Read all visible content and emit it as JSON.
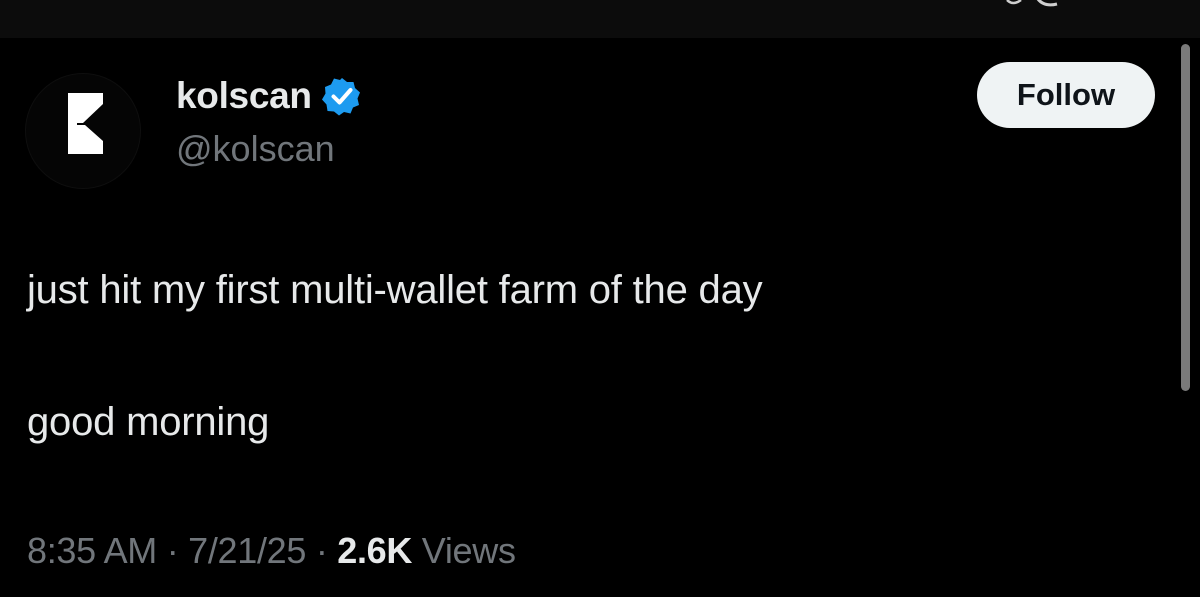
{
  "colors": {
    "background": "#000000",
    "primary_text": "#e7e9ea",
    "secondary_text": "#71767b",
    "verified_blue": "#1d9bf0",
    "follow_button_bg": "#eff3f4",
    "follow_button_text": "#0f1419"
  },
  "author": {
    "avatar_icon": "kolscan-logo-icon",
    "display_name": "kolscan",
    "verified_icon": "verified-badge-icon",
    "handle": "@kolscan"
  },
  "follow_label": "Follow",
  "post": {
    "line_1": "just hit my first multi-wallet farm of the day",
    "line_2": "good morning"
  },
  "meta": {
    "time": "8:35 AM",
    "separator": "·",
    "date": "7/21/25",
    "views_count": "2.6K",
    "views_label": "Views"
  }
}
